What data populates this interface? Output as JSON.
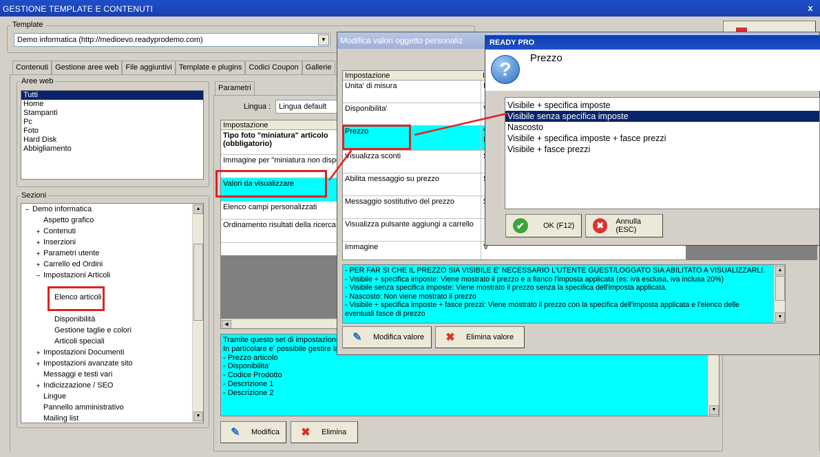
{
  "window": {
    "title": "GESTIONE TEMPLATE E CONTENUTI",
    "close_glyph": "x"
  },
  "template": {
    "label": "Template",
    "value": "Demo informatica (http://medioevo.readyprodemo.com)"
  },
  "tabs": [
    "Contenuti",
    "Gestione aree web",
    "File aggiuntivi",
    "Template e plugins",
    "Codici Coupon",
    "Gallerie"
  ],
  "aree_web": {
    "label": "Aree web",
    "items": [
      "Tutti",
      "Home",
      "Stampanti",
      "Pc",
      "Foto",
      "Hard Disk",
      "Abbigliamento"
    ]
  },
  "sezioni": {
    "label": "Sezioni",
    "items": [
      {
        "label": "Demo informatica",
        "expander": "−"
      },
      {
        "label": "Aspetto grafico",
        "expander": ""
      },
      {
        "label": "Contenuti",
        "expander": "+"
      },
      {
        "label": "Inserzioni",
        "expander": "+"
      },
      {
        "label": "Parametri utente",
        "expander": "+"
      },
      {
        "label": "Carrello ed Ordini",
        "expander": "+"
      },
      {
        "label": "Impostazioni Articoli",
        "expander": "−"
      },
      {
        "label": "Elenco articoli",
        "expander": ""
      },
      {
        "label": "Disponibilità",
        "expander": ""
      },
      {
        "label": "Gestione taglie e colori",
        "expander": ""
      },
      {
        "label": "Articoli speciali",
        "expander": ""
      },
      {
        "label": "Impostazioni Documenti",
        "expander": "+"
      },
      {
        "label": "Impostazioni avanzate sito",
        "expander": "+"
      },
      {
        "label": "Messaggi e testi vari",
        "expander": ""
      },
      {
        "label": "Indicizzazione / SEO",
        "expander": "+"
      },
      {
        "label": "Lingue",
        "expander": ""
      },
      {
        "label": "Pannello amministrativo",
        "expander": ""
      },
      {
        "label": "Mailing list",
        "expander": ""
      }
    ]
  },
  "parametri": {
    "tab": "Parametri",
    "lingua_label": "Lingua :",
    "lingua_value": "Lingua default",
    "grid_header": "Impostazione",
    "rows": [
      "Tipo foto \"miniatura\" articolo (obbligatorio)",
      "Immagine per \"miniatura non dispo",
      "Valori da visualizzare",
      "Elenco campi personalizzati",
      "Ordinamento risultati della ricerca"
    ],
    "description": [
      "Tramite questo set di impostazioni e",
      "In particolare e' possibile gestire la",
      "- Prezzo articolo",
      "- Disponibilita'",
      "- Codice Prodotto",
      "- Descrizione 1",
      "- Descrizione 2"
    ],
    "btn_modifica": "Modifica",
    "btn_elimina": "Elimina"
  },
  "modifica_dialog": {
    "title": "Modifica valori oggetto personaliz",
    "grid_header": "Impostazione",
    "grid_header2": "I",
    "rows": [
      {
        "label": "Unita' di misura",
        "value": "N"
      },
      {
        "label": "Disponibilita'",
        "value": "V"
      },
      {
        "label": "Prezzo",
        "value": "V"
      },
      {
        "label": "Visualizza sconti",
        "value": "S"
      },
      {
        "label": "Abilita messaggio su prezzo",
        "value": "S"
      },
      {
        "label": "Messaggio sostitutivo del prezzo",
        "value": "$"
      },
      {
        "label": "Visualizza pulsante aggiungi a carrello",
        "value": ""
      },
      {
        "label": "Immagine",
        "value": "V"
      }
    ],
    "prezzo_value2": "P",
    "help": [
      "- PER FAR SI CHE IL PREZZO SIA VISIBILE E' NECESSARIO L'UTENTE GUEST/LOGGATO SIA ABILITATO A VISUALIZZARLI.",
      "- Visibile + specifica imposte: Viene mostrato il prezzo e a fianco l'imposta applicata (es: iva esclusa, iva inclusa 20%)",
      "- Visibile senza specifica imposte: Viene mostrato il prezzo senza la specifica dell'imposta applicata.",
      "- Nascosto: Non viene mostrato il prezzo",
      "- Visibile + specifica imposte + fasce prezzi: Viene mostrato il prezzo con la specifica dell'imposta applicata e l'elenco delle",
      "eventuali fasce di prezzo"
    ],
    "btn_modifica": "Modifica valore",
    "btn_elimina": "Elimina valore"
  },
  "ready_pro": {
    "title": "READY PRO",
    "heading": "Prezzo",
    "options": [
      "Visibile + specifica imposte",
      "Visibile senza specifica imposte",
      "Nascosto",
      "Visibile + specifica imposte + fasce prezzi",
      "Visibile + fasce prezzi"
    ],
    "selected_index": 1,
    "btn_ok": "OK (F12)",
    "btn_annulla": "Annulla (ESC)"
  },
  "colors": {
    "accent": "#0a246a",
    "highlight": "#00ffff",
    "annotation": "#e02020"
  }
}
